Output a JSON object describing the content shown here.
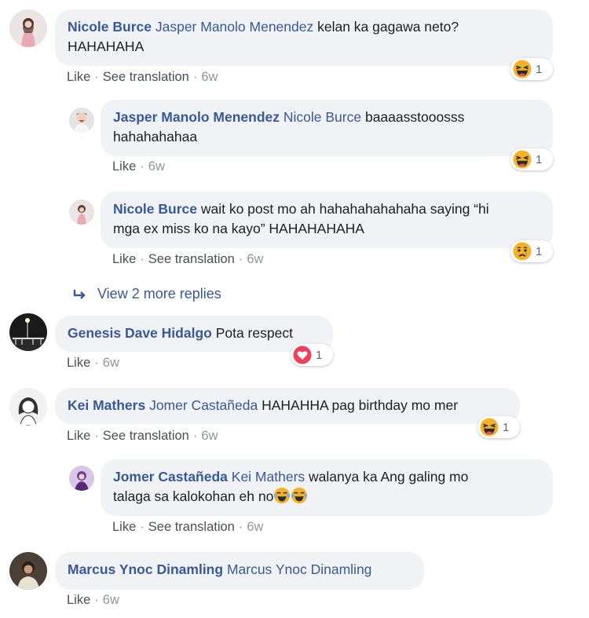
{
  "colors": {
    "link": "#385898",
    "bubble": "#f0f2f5",
    "meta": "#90949c",
    "haha": "#f7b125",
    "love": "#f33e58"
  },
  "comments": [
    {
      "author": "Nicole Burce",
      "mention": "Jasper Manolo Menendez",
      "text_line1": " kelan ka gagawa neto?",
      "text_line2": "HAHAHAHA",
      "like": "Like",
      "translate": "See translation",
      "time": "6w",
      "reaction": {
        "icon": "haha-icon",
        "count": "1"
      }
    },
    {
      "author": "Jasper Manolo Menendez",
      "mention": "Nicole Burce",
      "text_line1": " baaaasstooosss",
      "text_line2": "hahahahahaa",
      "like": "Like",
      "time": "6w",
      "reaction": {
        "icon": "haha-icon",
        "count": "1"
      }
    },
    {
      "author": "Nicole Burce",
      "text_line1": " wait ko post mo ah hahahahahahaha saying “hi",
      "text_line2": "mga ex miss ko na kayo” HAHAHAHAHA",
      "like": "Like",
      "translate": "See translation",
      "time": "6w",
      "reaction": {
        "icon": "sad-icon",
        "count": "1"
      }
    },
    {
      "author": "Genesis Dave Hidalgo",
      "text": " Pota respect",
      "like": "Like",
      "time": "6w",
      "reaction": {
        "icon": "love-icon",
        "count": "1"
      }
    },
    {
      "author": "Kei Mathers",
      "mention": "Jomer Castañeda",
      "text": " HAHAHHA pag birthday mo mer",
      "like": "Like",
      "translate": "See translation",
      "time": "6w",
      "reaction": {
        "icon": "haha-icon",
        "count": "1"
      }
    },
    {
      "author": "Jomer Castañeda",
      "mention": "Kei Mathers",
      "text_line1": " walanya ka Ang galing mo",
      "text_line2": "talaga sa kalokohan eh no",
      "like": "Like",
      "translate": "See translation",
      "time": "6w"
    },
    {
      "author": "Marcus Ynoc Dinamling",
      "mention": "Marcus Ynoc Dinamling",
      "like": "Like",
      "time": "6w"
    }
  ],
  "view_more": "View 2 more replies",
  "separator": "·"
}
